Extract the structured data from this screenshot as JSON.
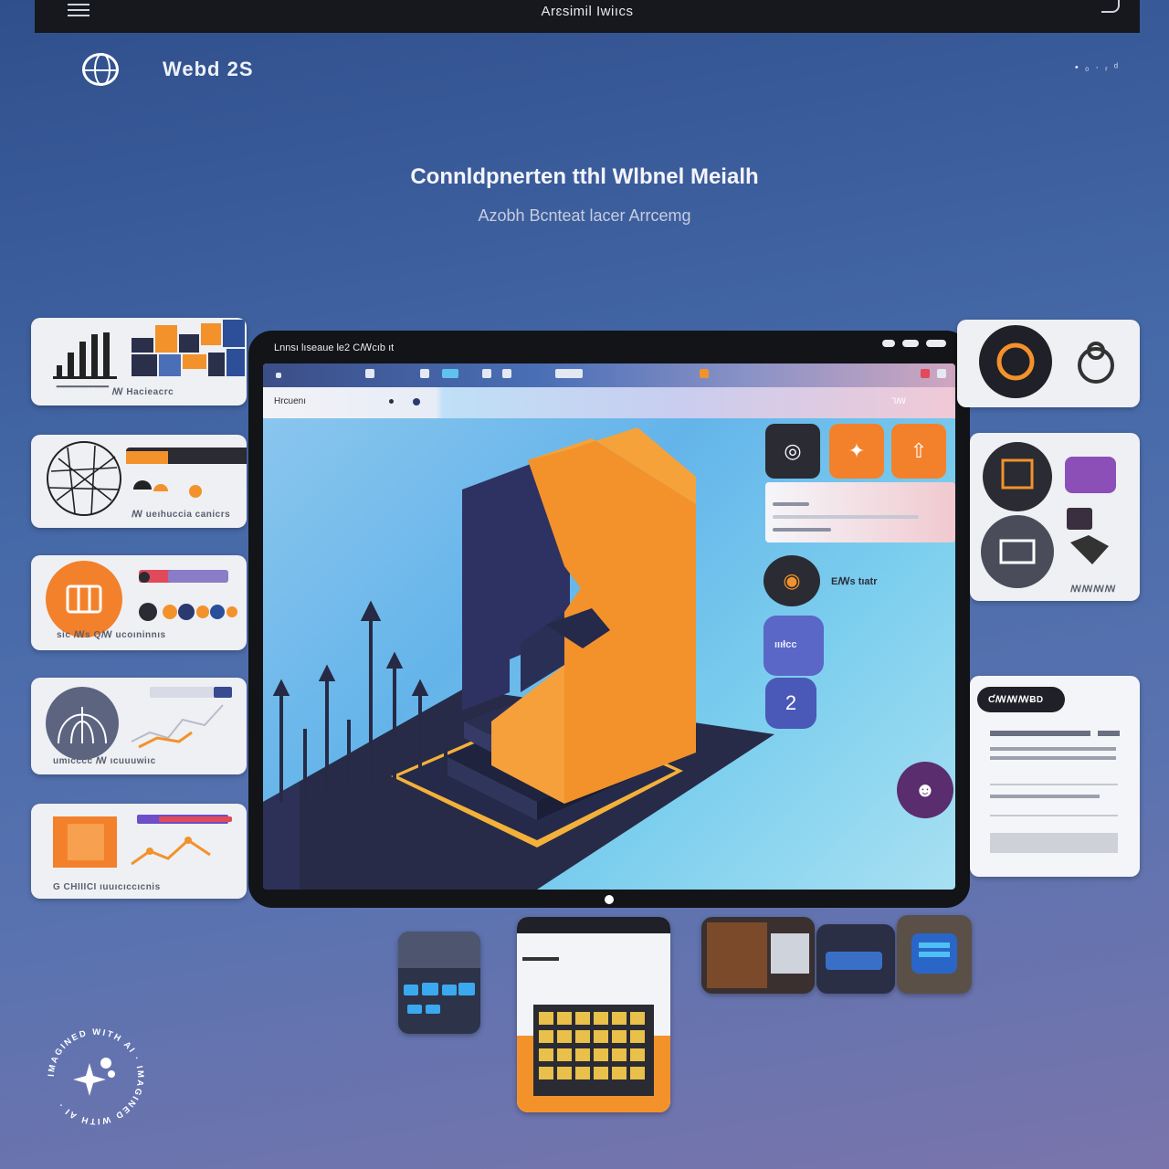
{
  "topbar": {
    "title": "Arɛsimil Iwiıcs"
  },
  "brand": {
    "name": "Webd 2S",
    "status": "• ₀ · ᵣ ᵈ"
  },
  "hero": {
    "title": "Connldpnerten tthl Wlbnel Meialh",
    "subtitle": "Azobh Bcnteat lacer Arrcemg"
  },
  "left_cards": [
    {
      "caption": "▔▔▔▔▔▔▔    ꟿ Hacieacrc"
    },
    {
      "caption": "ꟿ ueıhuccia canicrs"
    },
    {
      "caption": "sic ꟿs   Qꟿ ucoıninnıs"
    },
    {
      "caption": "umıcccc ꟿ ıcuuuwiıc"
    },
    {
      "caption": "G CHIIICI   ıuuıcıccıcnis"
    }
  ],
  "main_window": {
    "title": "Lnnsı lıseaue le2   Cꟿcıb ıt",
    "address_label": "Hrcuenı",
    "address_right": "Ꞁꟿ",
    "side_label": "Eꟿs tıatr",
    "pill_label": "ıııłcc"
  },
  "right_cards": {
    "card2_caption": "ꟿꟿꟿꟿ",
    "card3_badge": "ƇꟿꟿꟿɃD"
  },
  "badge": {
    "text": "IMAGINED WITH AI · IMAGINED WITH AI ·"
  },
  "colors": {
    "accent_orange": "#f3922b",
    "navy": "#2d3262",
    "window_dark": "#121418",
    "card_bg": "#eef0f4"
  },
  "icons": [
    "hamburger-icon",
    "globe-icon",
    "sparkle-icon"
  ]
}
